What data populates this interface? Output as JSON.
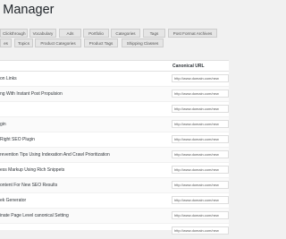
{
  "page": {
    "title": "l Manager"
  },
  "tabs_row1": [
    "Clickthrough",
    "Vocabulary",
    "Ads",
    "Portfolio",
    "Categories",
    "Tags",
    "Post Format Archives"
  ],
  "tabs_row2": [
    "es",
    "Topics",
    "Product Categories",
    "Product Tags",
    "Shipping Classes"
  ],
  "table": {
    "col_canonical_url": "Canonical URL",
    "rows": [
      {
        "title": "on Links",
        "url": "http://www.domain.com/new"
      },
      {
        "title": "ng With Instant Post Propulsion",
        "url": "http://www.domain.com/new"
      },
      {
        "title": "",
        "url": "http://www.domain.com/new"
      },
      {
        "title": "gin",
        "url": "http://www.domain.com/new"
      },
      {
        "title": "Right SEO Plugin",
        "url": "http://www.domain.com/new"
      },
      {
        "title": "revention Tips Using Indexation And Crawl Prioritization",
        "url": "http://www.domain.com/new"
      },
      {
        "title": "ess Markup Using Rich Snippets",
        "url": "http://www.domain.com/new"
      },
      {
        "title": "ontent For New SEO Results",
        "url": "http://www.domain.com/new"
      },
      {
        "title": "ek Generator",
        "url": "http://www.domain.com/new"
      },
      {
        "title": "inate Page Level canonical Setting",
        "url": "http://www.domain.com/new"
      },
      {
        "title": "",
        "url": "http://www.domain.com/new"
      }
    ]
  }
}
